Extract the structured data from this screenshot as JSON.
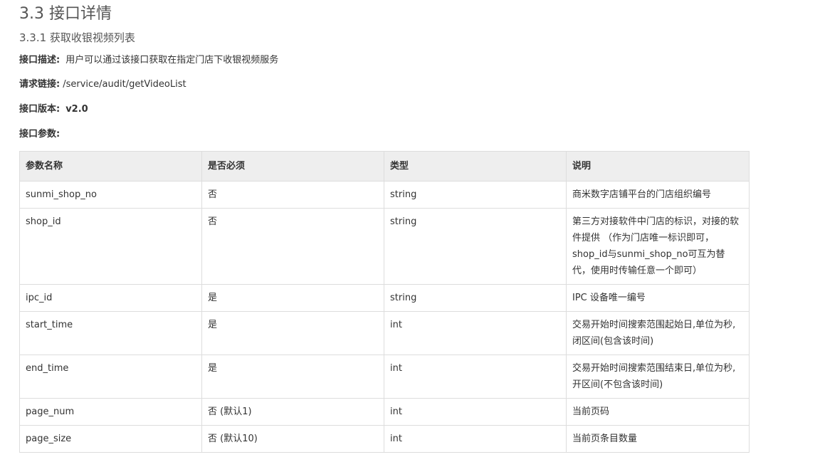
{
  "section_title": "3.3 接口详情",
  "subsection_title": "3.3.1 获取收银视频列表",
  "description": {
    "label": "接口描述:",
    "value": "用户可以通过该接口获取在指定门店下收银视频服务"
  },
  "request_link": {
    "label": "请求链接:",
    "value": "/service/audit/getVideoList"
  },
  "version": {
    "label": "接口版本:",
    "value": "v2.0"
  },
  "params_label": "接口参数:",
  "table": {
    "headers": [
      "参数名称",
      "是否必须",
      "类型",
      "说明"
    ],
    "rows": [
      {
        "name": "sunmi_shop_no",
        "required": "否",
        "type": "string",
        "desc": "商米数字店铺平台的门店组织编号"
      },
      {
        "name": "shop_id",
        "required": "否",
        "type": "string",
        "desc": "第三方对接软件中门店的标识，对接的软件提供 （作为门店唯一标识即可，shop_id与sunmi_shop_no可互为替代，使用时传输任意一个即可）"
      },
      {
        "name": "ipc_id",
        "required": "是",
        "type": "string",
        "desc": "IPC 设备唯一编号"
      },
      {
        "name": "start_time",
        "required": "是",
        "type": "int",
        "desc": "交易开始时间搜索范围起始日,单位为秒,闭区间(包含该时间)"
      },
      {
        "name": "end_time",
        "required": "是",
        "type": "int",
        "desc": "交易开始时间搜索范围结束日,单位为秒,开区间(不包含该时间)"
      },
      {
        "name": "page_num",
        "required": "否 (默认1)",
        "type": "int",
        "desc": "当前页码"
      },
      {
        "name": "page_size",
        "required": "否 (默认10)",
        "type": "int",
        "desc": "当前页条目数量"
      }
    ]
  }
}
